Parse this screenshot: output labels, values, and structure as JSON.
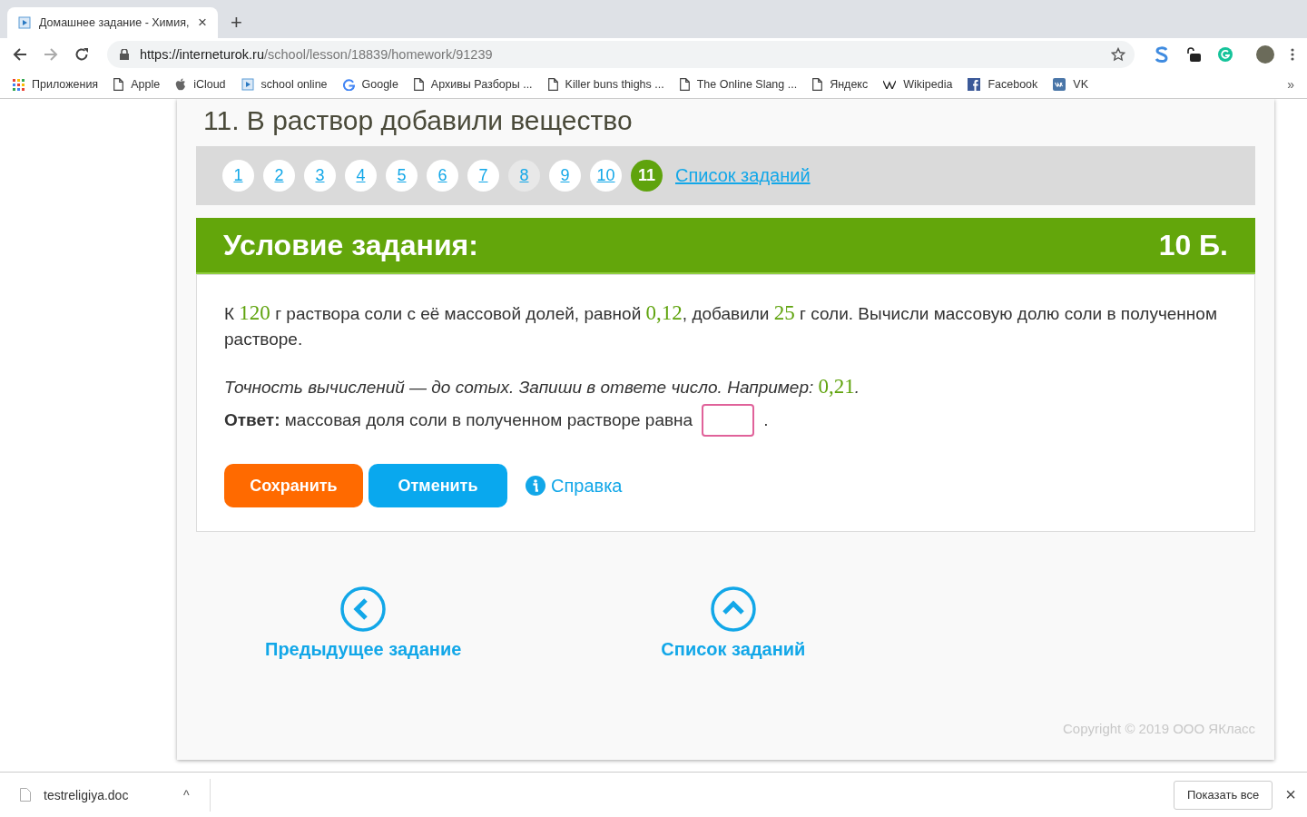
{
  "browser": {
    "tab": {
      "title": "Домашнее задание - Химия,",
      "close": "×"
    },
    "new_tab": "+",
    "url": {
      "host": "https://interneturok.ru",
      "path": "/school/lesson/18839/homework/91239"
    },
    "bookmarks": [
      {
        "kind": "apps",
        "label": "Приложения"
      },
      {
        "kind": "page",
        "label": "Apple"
      },
      {
        "kind": "apple",
        "label": "iCloud"
      },
      {
        "kind": "play",
        "label": "school online"
      },
      {
        "kind": "google",
        "label": "Google"
      },
      {
        "kind": "page",
        "label": "Архивы Разборы ..."
      },
      {
        "kind": "page",
        "label": "Killer buns thighs ..."
      },
      {
        "kind": "page",
        "label": "The Online Slang ..."
      },
      {
        "kind": "page",
        "label": "Яндекс"
      },
      {
        "kind": "wiki",
        "label": "Wikipedia"
      },
      {
        "kind": "facebook",
        "label": "Facebook"
      },
      {
        "kind": "vk",
        "label": "VK"
      }
    ],
    "more": "»"
  },
  "page": {
    "heading": "11. В раствор добавили вещество",
    "pagination": [
      {
        "label": "1",
        "selected": false,
        "visited": false
      },
      {
        "label": "2",
        "selected": false,
        "visited": false
      },
      {
        "label": "3",
        "selected": false,
        "visited": false
      },
      {
        "label": "4",
        "selected": false,
        "visited": false
      },
      {
        "label": "5",
        "selected": false,
        "visited": false
      },
      {
        "label": "6",
        "selected": false,
        "visited": false
      },
      {
        "label": "7",
        "selected": false,
        "visited": false
      },
      {
        "label": "8",
        "selected": false,
        "visited": true
      },
      {
        "label": "9",
        "selected": false,
        "visited": false
      },
      {
        "label": "10",
        "selected": false,
        "visited": false
      },
      {
        "label": "11",
        "selected": true,
        "visited": false
      }
    ],
    "task_list_link": "Список заданий",
    "condition": {
      "title": "Условие задания:",
      "points": "10 Б.",
      "problem": [
        {
          "kind": "text",
          "text": "К "
        },
        {
          "kind": "number",
          "text": "120"
        },
        {
          "kind": "text",
          "text": " г раствора соли с её массовой долей, равной "
        },
        {
          "kind": "number",
          "text": "0,12"
        },
        {
          "kind": "text",
          "text": ", добавили "
        },
        {
          "kind": "number",
          "text": "25"
        },
        {
          "kind": "text",
          "text": " г соли. Вычисли массовую долю соли в полученном растворе."
        }
      ],
      "hint": [
        {
          "kind": "text",
          "text": "Точность вычислений — до сотых. Запиши в ответе число. Например: "
        },
        {
          "kind": "number",
          "text": "0,21"
        },
        {
          "kind": "text",
          "text": "."
        }
      ],
      "answer_label": "Ответ:",
      "answer_text": "массовая доля соли в полученном растворе равна",
      "answer_end": "."
    },
    "buttons": [
      {
        "kind": "save",
        "label": "Сохранить"
      },
      {
        "kind": "cancel",
        "label": "Отменить"
      }
    ],
    "help_link": "Справка",
    "prev_link": "Предыдущее задание",
    "list_link": "Список заданий",
    "copyright": "Copyright © 2019 ООО ЯКласс"
  },
  "downloads": {
    "file": "testreligiya.doc",
    "caret": "^",
    "show_all": "Показать все",
    "close": "×"
  }
}
